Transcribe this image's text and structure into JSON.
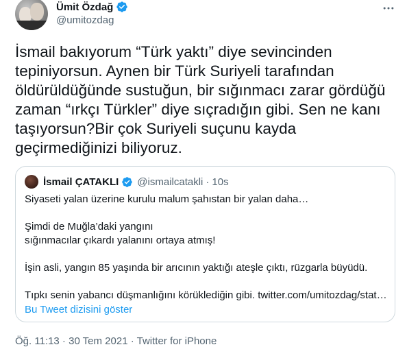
{
  "tweet": {
    "author_name": "Ümit Özdağ",
    "author_handle": "@umitozdag",
    "text": "İsmail bakıyorum “Türk yaktı” diye sevincinden tepiniyorsun. Aynen bir Türk Suriyeli tarafından öldürüldüğünde sustuğun, bir sığınmacı zarar gördüğü zaman “ırkçı Türkler” diye sıçradığın gibi. Sen ne kanı taşıyorsun?Bir çok Suriyeli suçunu kayda geçirmediğinizi biliyoruz.",
    "footer_partial": "Öğ. 11:13 · 30 Tem 2021 · Twitter for iPhone"
  },
  "quoted": {
    "author_name": "İsmail ÇATAKLI",
    "author_handle": "@ismailcatakli",
    "separator": "·",
    "time": "10s",
    "lines": [
      "Siyaseti yalan üzerine kurulu malum şahıstan bir yalan daha…",
      "",
      "Şimdi de Muğla’daki yangını",
      "sığınmacılar çıkardı yalanını ortaya atmış!",
      "",
      "İşin asli, yangın 85 yaşında bir arıcının yaktığı ateşle çıktı, rüzgarla büyüdü.",
      "",
      "Tıpkı senin yabancı düşmanlığını körüklediğin gibi. twitter.com/umitozdag/stat…"
    ],
    "show_thread": "Bu Tweet dizisini göster"
  },
  "colors": {
    "text": "#0f1419",
    "secondary": "#536471",
    "accent": "#1d9bf0",
    "border": "#cfd9de"
  },
  "icons": {
    "verified": "verified-badge-icon",
    "more": "more-options-icon"
  }
}
